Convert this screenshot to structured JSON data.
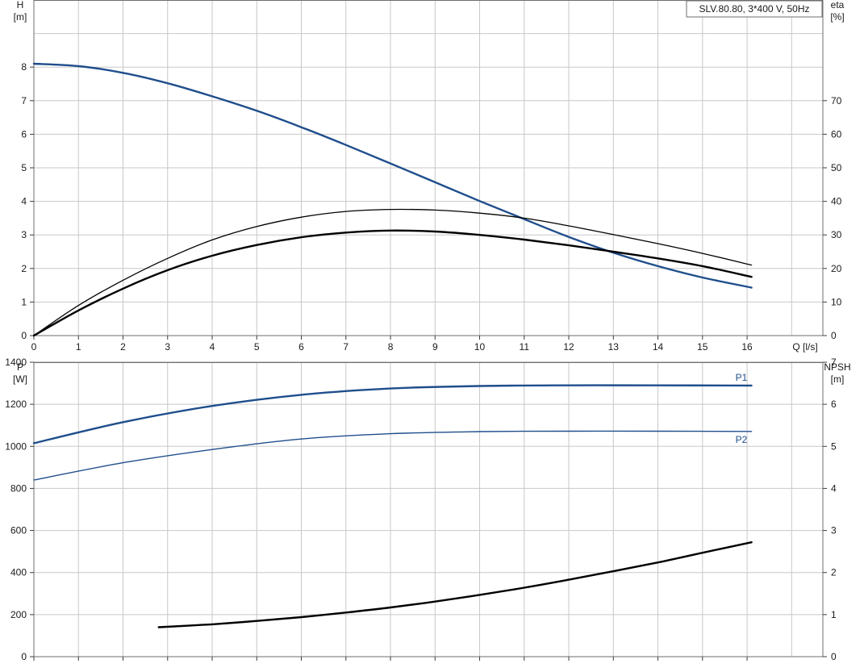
{
  "chart_data": [
    {
      "type": "line",
      "title": "SLV.80.80, 3*400 V, 50Hz",
      "xlabel": "Q [l/s]",
      "ylabel_left": [
        "H",
        "[m]"
      ],
      "ylabel_right": [
        "eta",
        "[%]"
      ],
      "xlim": [
        0,
        17.7
      ],
      "ylim_left": [
        0,
        10
      ],
      "ylim_right": [
        0,
        100
      ],
      "x_ticks": [
        0,
        1,
        2,
        3,
        4,
        5,
        6,
        7,
        8,
        9,
        10,
        11,
        12,
        13,
        14,
        15,
        16
      ],
      "y_ticks_left": [
        0,
        1,
        2,
        3,
        4,
        5,
        6,
        7,
        8
      ],
      "y_ticks_right": [
        0,
        10,
        20,
        30,
        40,
        50,
        60,
        70
      ],
      "grid": true,
      "series": [
        {
          "axis": "left",
          "color": "#1f4e8c",
          "width": 2.4,
          "x": [
            0,
            1,
            2,
            3,
            4,
            5,
            6,
            7,
            8,
            9,
            10,
            11,
            12,
            13,
            14,
            15,
            16.1
          ],
          "y": [
            8.1,
            8.03,
            7.83,
            7.52,
            7.13,
            6.7,
            6.21,
            5.68,
            5.13,
            4.57,
            4.01,
            3.47,
            2.94,
            2.47,
            2.07,
            1.73,
            1.43
          ]
        },
        {
          "axis": "right",
          "color": "#000000",
          "width": 1.3,
          "x": [
            0,
            1,
            2,
            3,
            4,
            5,
            6,
            7,
            8,
            9,
            10,
            11,
            12,
            13,
            14,
            15,
            16.1
          ],
          "y": [
            0,
            9,
            16.5,
            23,
            28.5,
            32.5,
            35.3,
            37,
            37.6,
            37.4,
            36.5,
            35,
            32.7,
            30.1,
            27.4,
            24.5,
            21
          ]
        },
        {
          "axis": "right",
          "color": "#000000",
          "width": 2.4,
          "x": [
            0,
            1,
            2,
            3,
            4,
            5,
            6,
            7,
            8,
            9,
            10,
            11,
            12,
            13,
            14,
            15,
            16.1
          ],
          "y": [
            0,
            7.5,
            14,
            19.5,
            23.8,
            27,
            29.3,
            30.7,
            31.3,
            31,
            30,
            28.6,
            26.9,
            25,
            23,
            20.7,
            17.5
          ]
        }
      ]
    },
    {
      "type": "line",
      "ylabel_left": [
        "P",
        "[W]"
      ],
      "ylabel_right": [
        "NPSH",
        "[m]"
      ],
      "xlim": [
        0,
        17.7
      ],
      "ylim_left": [
        0,
        1400
      ],
      "ylim_right": [
        0,
        7
      ],
      "x_ticks": [
        0,
        1,
        2,
        3,
        4,
        5,
        6,
        7,
        8,
        9,
        10,
        11,
        12,
        13,
        14,
        15,
        16
      ],
      "y_ticks_left": [
        0,
        200,
        400,
        600,
        800,
        1000,
        1200,
        1400
      ],
      "y_ticks_right": [
        0,
        1,
        2,
        3,
        4,
        5,
        6,
        7
      ],
      "grid": true,
      "series": [
        {
          "name": "P1",
          "axis": "left",
          "color": "#1f4e8c",
          "width": 2.4,
          "x": [
            0,
            2,
            4,
            6,
            8,
            10,
            12,
            14,
            16.1
          ],
          "y": [
            1015,
            1115,
            1192,
            1245,
            1275,
            1287,
            1290,
            1290,
            1289
          ]
        },
        {
          "name": "P2",
          "axis": "left",
          "color": "#1f4e8c",
          "width": 1.4,
          "x": [
            0,
            2,
            4,
            6,
            8,
            10,
            12,
            14,
            16.1
          ],
          "y": [
            840,
            922,
            985,
            1035,
            1060,
            1070,
            1072,
            1072,
            1071
          ]
        },
        {
          "axis": "right",
          "color": "#000000",
          "width": 2.4,
          "x": [
            2.8,
            4,
            5,
            6,
            7,
            8,
            9,
            10,
            11,
            12,
            13,
            14,
            15,
            16.1
          ],
          "y": [
            0.7,
            0.77,
            0.85,
            0.94,
            1.05,
            1.17,
            1.31,
            1.47,
            1.64,
            1.83,
            2.03,
            2.24,
            2.47,
            2.72
          ]
        }
      ]
    }
  ]
}
